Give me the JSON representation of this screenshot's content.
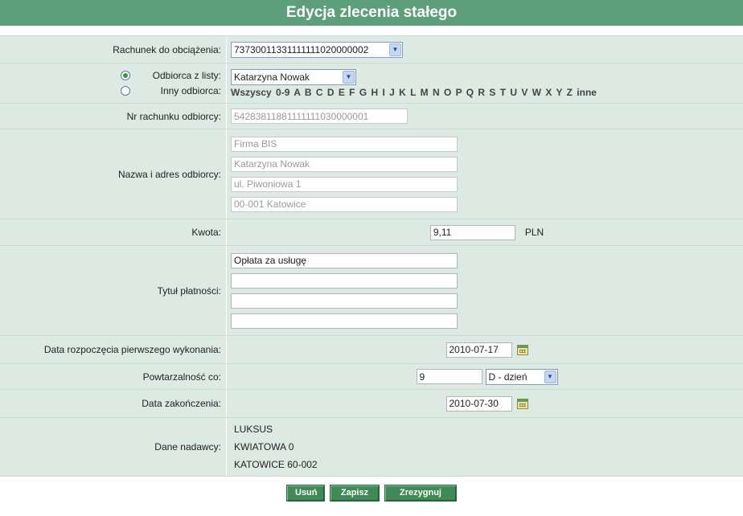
{
  "header": {
    "title": "Edycja zlecenia stałego"
  },
  "account": {
    "label": "Rachunek do obciążenia:",
    "value": "73730011331111111020000002"
  },
  "recipient": {
    "from_list_label": "Odbiorca z listy:",
    "other_label": "Inny odbiorca:",
    "selected": "Katarzyna Nowak",
    "letters": "Wszyscy 0-9 A B C D E F G H I J K L M N O P Q R S T U V W X Y Z inne"
  },
  "recipient_account": {
    "label": "Nr rachunku odbiorcy:",
    "value": "54283811881111111030000001"
  },
  "recipient_address": {
    "label": "Nazwa i adres odbiorcy:",
    "lines": [
      "Firma BIS",
      "Katarzyna Nowak",
      "ul. Piwoniowa 1",
      "00-001 Katowice"
    ]
  },
  "amount": {
    "label": "Kwota:",
    "value": "9,11",
    "currency": "PLN"
  },
  "title": {
    "label": "Tytuł płatności:",
    "lines": [
      "Opłata za usługę",
      "",
      "",
      ""
    ]
  },
  "start_date": {
    "label": "Data rozpoczęcia pierwszego wykonania:",
    "value": "2010-07-17"
  },
  "repeat": {
    "label": "Powtarzalność co:",
    "value": "9",
    "unit": "D - dzień"
  },
  "end_date": {
    "label": "Data zakończenia:",
    "value": "2010-07-30"
  },
  "sender": {
    "label": "Dane nadawcy:",
    "lines": [
      "LUKSUS",
      "KWIATOWA 0",
      "KATOWICE 60-002"
    ]
  },
  "buttons": {
    "delete": "Usuń",
    "save": "Zapisz",
    "cancel": "Zrezygnuj"
  },
  "icons": {
    "calendar": "calendar-icon",
    "dropdown": "chevron-down-icon"
  }
}
